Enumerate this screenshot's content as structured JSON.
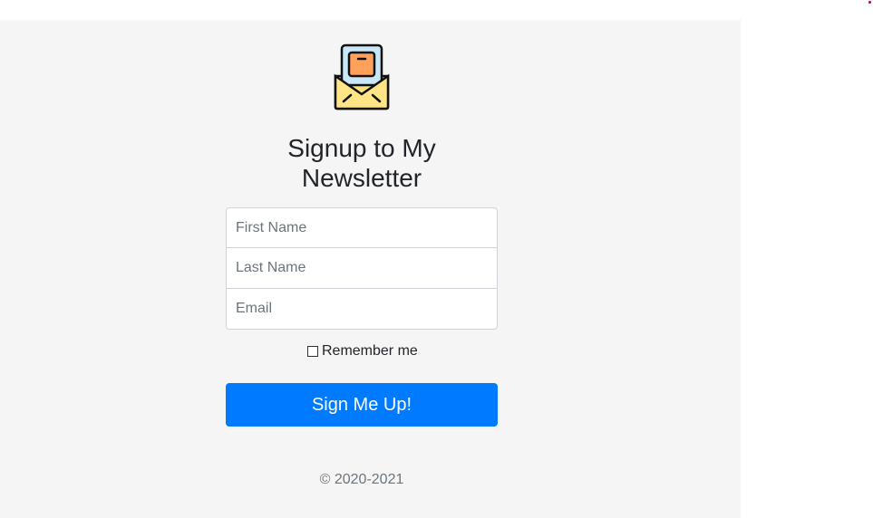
{
  "logo": {
    "icon": "newsletter-envelope-icon"
  },
  "heading": {
    "title": "Signup to My Newsletter"
  },
  "form": {
    "first_name_placeholder": "First Name",
    "last_name_placeholder": "Last Name",
    "email_placeholder": "Email",
    "remember_label": "Remember me",
    "submit_label": "Sign Me Up!"
  },
  "footer": {
    "copyright": "© 2020-2021"
  },
  "colors": {
    "panel_bg": "#f5f5f5",
    "button_bg": "#007bff",
    "button_text": "#ffffff"
  }
}
